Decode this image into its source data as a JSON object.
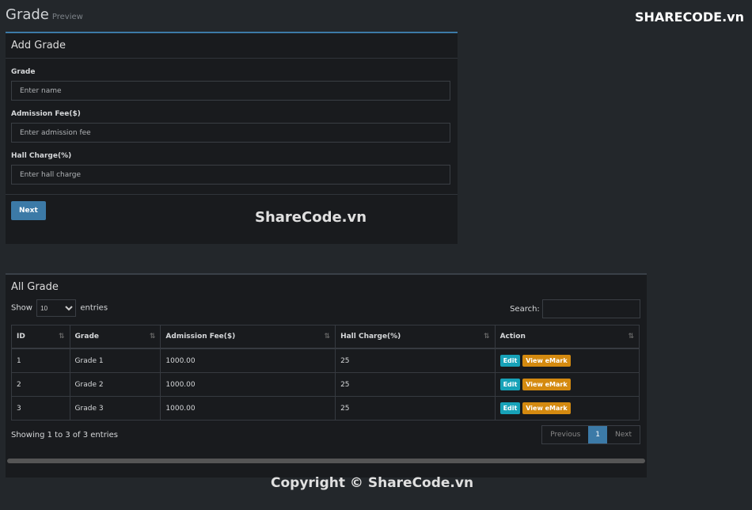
{
  "header": {
    "title": "Grade",
    "subtitle": "Preview",
    "logo": "SHARECODE.vn"
  },
  "form": {
    "title": "Add Grade",
    "fields": [
      {
        "label": "Grade",
        "placeholder": "Enter name"
      },
      {
        "label": "Admission Fee($)",
        "placeholder": "Enter admission fee"
      },
      {
        "label": "Hall Charge(%)",
        "placeholder": "Enter hall charge"
      }
    ],
    "next": "Next"
  },
  "table": {
    "title": "All Grade",
    "show": "Show",
    "entries_value": "10",
    "entries": "entries",
    "search": "Search:",
    "columns": [
      "ID",
      "Grade",
      "Admission Fee($)",
      "Hall Charge(%)",
      "Action"
    ],
    "rows": [
      [
        "1",
        "Grade 1",
        "1000.00",
        "25"
      ],
      [
        "2",
        "Grade 2",
        "1000.00",
        "25"
      ],
      [
        "3",
        "Grade 3",
        "1000.00",
        "25"
      ]
    ],
    "edit": "Edit",
    "view": "View eMark",
    "info": "Showing 1 to 3 of 3 entries",
    "prev": "Previous",
    "page": "1",
    "next": "Next"
  },
  "watermark": "ShareCode.vn",
  "copyright": "Copyright © ShareCode.vn"
}
